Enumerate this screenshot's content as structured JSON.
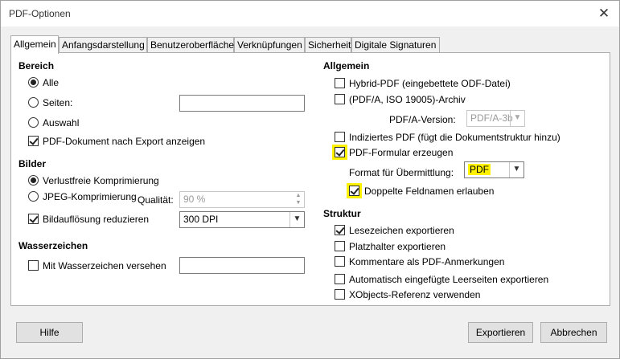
{
  "window": {
    "title": "PDF-Optionen",
    "close_glyph": "✕"
  },
  "tabs": [
    {
      "label": "Allgemein",
      "active": true
    },
    {
      "label": "Anfangsdarstellung"
    },
    {
      "label": "Benutzeroberfläche"
    },
    {
      "label": "Verknüpfungen"
    },
    {
      "label": "Sicherheit"
    },
    {
      "label": "Digitale Signaturen"
    }
  ],
  "bereich": {
    "heading": "Bereich",
    "alle": "Alle",
    "seiten": "Seiten:",
    "seiten_value": "",
    "auswahl": "Auswahl",
    "show_after_export": "PDF-Dokument nach Export anzeigen"
  },
  "bilder": {
    "heading": "Bilder",
    "lossless": "Verlustfreie Komprimierung",
    "jpeg": "JPEG-Komprimierung",
    "quality_label": "Qualität:",
    "quality_value": "90 %",
    "reduce_resolution": "Bildauflösung reduzieren",
    "resolution_value": "300 DPI"
  },
  "wasserzeichen": {
    "heading": "Wasserzeichen",
    "with_watermark": "Mit Wasserzeichen versehen",
    "watermark_value": ""
  },
  "allgemein": {
    "heading": "Allgemein",
    "hybrid": "Hybrid-PDF (eingebettete ODF-Datei)",
    "pdfa": "(PDF/A, ISO 19005)-Archiv",
    "pdfa_version_label": "PDF/A-Version:",
    "pdfa_version_value": "PDF/A-3b",
    "tagged": "Indiziertes PDF (fügt die Dokumentstruktur hinzu)",
    "form": "PDF-Formular erzeugen",
    "format_label": "Format für Übermittlung:",
    "format_value": "PDF",
    "duplicate_names": "Doppelte Feldnamen erlauben"
  },
  "struktur": {
    "heading": "Struktur",
    "bookmarks": "Lesezeichen exportieren",
    "placeholders": "Platzhalter exportieren",
    "comments": "Kommentare als PDF-Anmerkungen",
    "blank_pages": "Automatisch eingefügte Leerseiten exportieren",
    "xobjects": "XObjects-Referenz verwenden"
  },
  "buttons": {
    "help": "Hilfe",
    "export": "Exportieren",
    "cancel": "Abbrechen"
  },
  "colors": {
    "highlight": "#fff200",
    "panel_bg": "#ffffff",
    "window_bg": "#f0f0f0"
  },
  "icons": {
    "close": "close-icon",
    "dropdown": "chevron-down-icon",
    "spin": "spin-arrows-icon"
  }
}
